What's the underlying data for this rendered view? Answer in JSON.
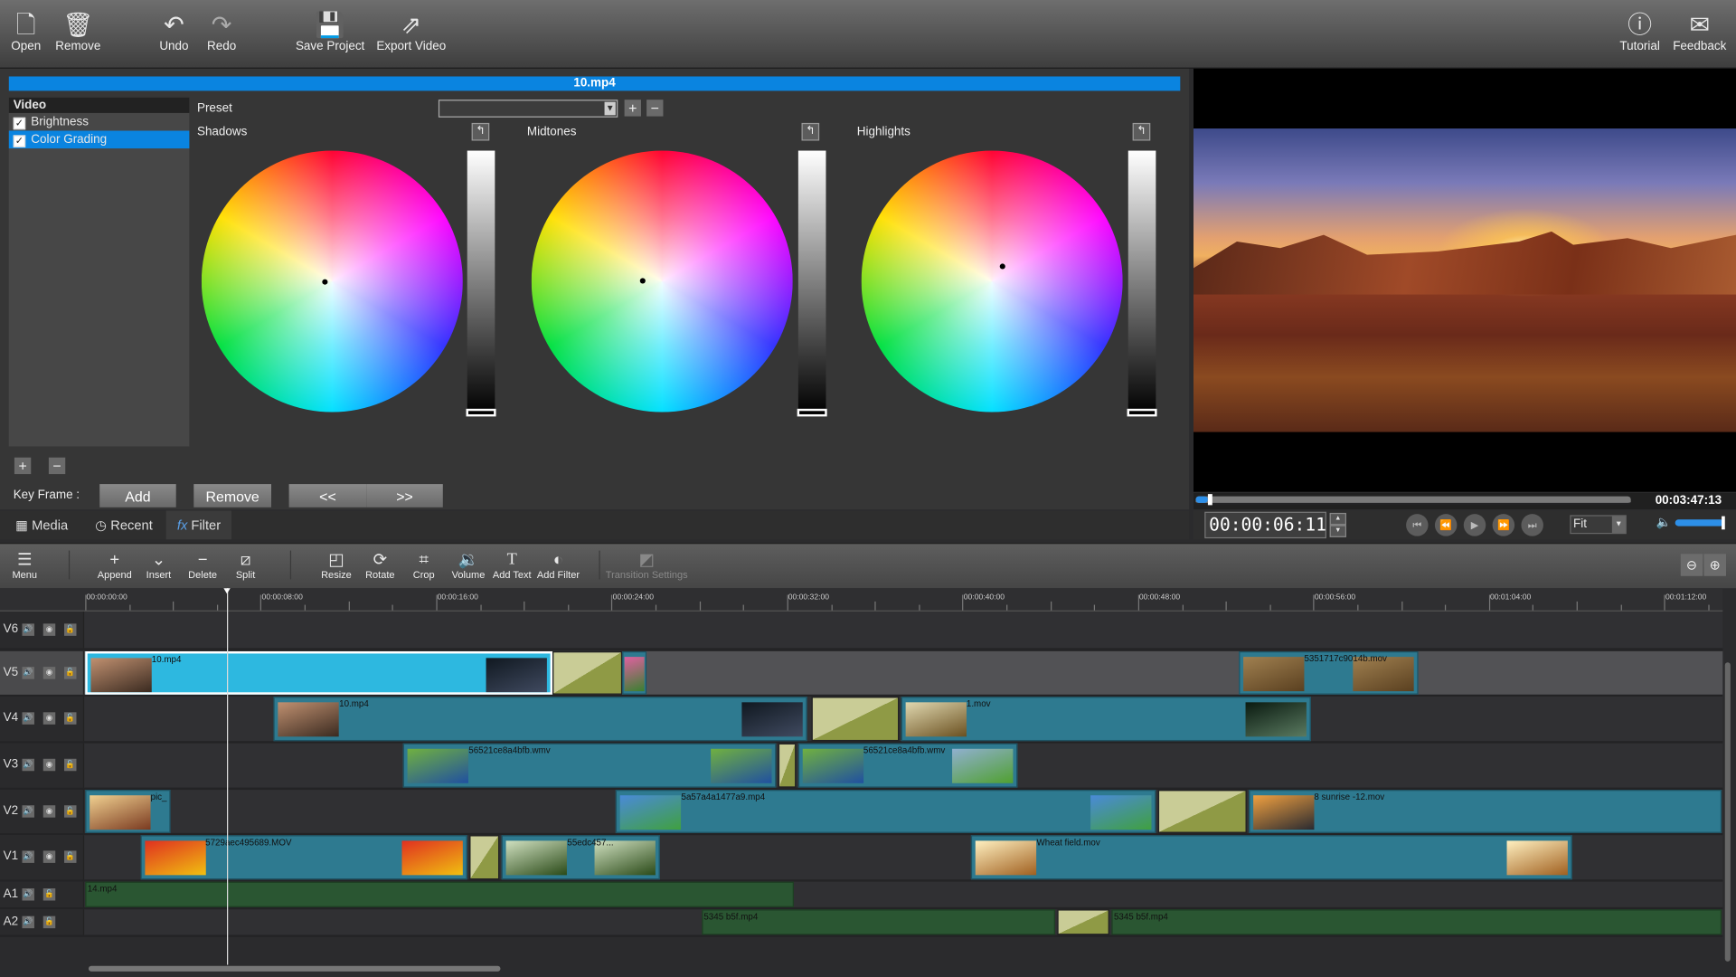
{
  "toolbar": {
    "open": "Open",
    "remove": "Remove",
    "undo": "Undo",
    "redo": "Redo",
    "save_project": "Save Project",
    "export_video": "Export Video",
    "tutorial": "Tutorial",
    "feedback": "Feedback"
  },
  "editor": {
    "clip_title": "10.mp4",
    "filter_list": {
      "header": "Video",
      "items": [
        {
          "label": "Brightness",
          "checked": true
        },
        {
          "label": "Color Grading",
          "checked": true,
          "selected": true
        }
      ]
    },
    "preset_label": "Preset",
    "preset_value": "",
    "wheels": [
      {
        "label": "Shadows"
      },
      {
        "label": "Midtones"
      },
      {
        "label": "Highlights"
      }
    ],
    "keyframe_label": "Key Frame :",
    "keyframe_add": "Add",
    "keyframe_remove": "Remove",
    "keyframe_prev": "<<",
    "keyframe_next": ">>"
  },
  "tabs": [
    {
      "label": "Media",
      "icon": "film-icon"
    },
    {
      "label": "Recent",
      "icon": "clock-icon"
    },
    {
      "label": "Filter",
      "icon": "fx-icon",
      "active": true
    }
  ],
  "preview": {
    "duration": "00:03:47:13",
    "current_time": "00:00:06:11",
    "zoom_mode": "Fit",
    "progress_percent": 2.8,
    "volume_percent": 100
  },
  "timeline_toolbar": {
    "menu": "Menu",
    "append": "Append",
    "insert": "Insert",
    "delete": "Delete",
    "split": "Split",
    "resize": "Resize",
    "rotate": "Rotate",
    "crop": "Crop",
    "volume": "Volume",
    "add_text": "Add Text",
    "add_filter": "Add Filter",
    "transition_settings": "Transition Settings"
  },
  "ruler": [
    "00:00:00:00",
    "00:00:08:00",
    "00:00:16:00",
    "00:00:24:00",
    "00:00:32:00",
    "00:00:40:00",
    "00:00:48:00",
    "00:00:56:00",
    "00:01:04:00",
    "00:01:12:00"
  ],
  "playhead_seconds": 6.46,
  "colors": {
    "accent": "#0a84e0",
    "video_clip": "#2e7a90",
    "selected_clip": "#2db8e0",
    "audio_clip": "#2a5632",
    "transition": "#8f9a45"
  },
  "tracks": [
    {
      "name": "V6",
      "type": "video",
      "clips": []
    },
    {
      "name": "V5",
      "type": "video",
      "selected": true,
      "clips": [
        {
          "label": "10.mp4",
          "start": 0,
          "end": 21.3,
          "selected": true,
          "thumbs": [
            [
              "#c09070",
              "#3a2a20"
            ],
            [
              "#101820",
              "#404a60"
            ]
          ]
        },
        {
          "transition": true,
          "start": 21.3,
          "end": 24.5
        },
        {
          "label": "",
          "start": 24.5,
          "end": 25.6,
          "thumbs": [
            [
              "#e060a0",
              "#3a8030"
            ]
          ]
        },
        {
          "label": "5351717c9014b.mov",
          "start": 52.6,
          "end": 60.8,
          "thumbs": [
            [
              "#a08050",
              "#5a4020"
            ],
            [
              "#a08050",
              "#5a4020"
            ]
          ]
        }
      ]
    },
    {
      "name": "V4",
      "type": "video",
      "clips": [
        {
          "label": "10.mp4",
          "start": 8.6,
          "end": 32.9,
          "thumbs": [
            [
              "#c09070",
              "#3a2a20"
            ],
            [
              "#101820",
              "#404a60"
            ]
          ]
        },
        {
          "transition": true,
          "start": 33.1,
          "end": 37.1
        },
        {
          "label": "1.mov",
          "start": 37.2,
          "end": 55.9,
          "thumbs": [
            [
              "#e0d8b0",
              "#6a5020"
            ],
            [
              "#0a1a10",
              "#5a7a60"
            ]
          ]
        }
      ]
    },
    {
      "name": "V3",
      "type": "video",
      "clips": [
        {
          "label": "56521ce8a4bfb.wmv",
          "start": 14.5,
          "end": 31.5,
          "thumbs": [
            [
              "#70b040",
              "#2050a0"
            ],
            [
              "#70b040",
              "#2050a0"
            ]
          ]
        },
        {
          "transition": true,
          "start": 31.6,
          "end": 32.4
        },
        {
          "label": "56521ce8a4bfb.wmv",
          "start": 32.5,
          "end": 42.5,
          "thumbs": [
            [
              "#70b040",
              "#2050a0"
            ],
            [
              "#90b0d0",
              "#50a030"
            ]
          ]
        }
      ]
    },
    {
      "name": "V2",
      "type": "video",
      "clips": [
        {
          "label": "pic_",
          "start": 0,
          "end": 3.9,
          "thumbs": [
            [
              "#f0d090",
              "#7a3a20"
            ]
          ]
        },
        {
          "label": "5a57a4a1477a9.mp4",
          "start": 24.2,
          "end": 48.8,
          "thumbs": [
            [
              "#4a8ad8",
              "#40a040"
            ],
            [
              "#4a8ad8",
              "#40a040"
            ]
          ]
        },
        {
          "transition": true,
          "start": 48.9,
          "end": 52.96
        },
        {
          "label": "8 sunrise -12.mov",
          "start": 53.05,
          "end": 74.6,
          "thumbs": [
            [
              "#f0a040",
              "#2a2a30"
            ]
          ]
        }
      ]
    },
    {
      "name": "V1",
      "type": "video",
      "clips": [
        {
          "label": "5729aec495689.MOV",
          "start": 2.5,
          "end": 17.4,
          "thumbs": [
            [
              "#e03020",
              "#f0c010"
            ],
            [
              "#e03020",
              "#f0c010"
            ]
          ]
        },
        {
          "transition": true,
          "start": 17.5,
          "end": 18.9
        },
        {
          "label": "55edc457...",
          "start": 19.0,
          "end": 26.2,
          "thumbs": [
            [
              "#d0e0c0",
              "#2a4a18"
            ],
            [
              "#d0e0c0",
              "#2a4a18"
            ]
          ]
        },
        {
          "label": "Wheat field.mov",
          "start": 40.4,
          "end": 67.8,
          "thumbs": [
            [
              "#fff0c0",
              "#a06020"
            ],
            [
              "#fff0c0",
              "#a06020"
            ]
          ]
        }
      ]
    },
    {
      "name": "A1",
      "type": "audio",
      "clips": [
        {
          "label": "14.mp4",
          "start": 0,
          "end": 32.3
        }
      ]
    },
    {
      "name": "A2",
      "type": "audio",
      "clips": [
        {
          "label": "5345 b5f.mp4",
          "start": 28.1,
          "end": 44.2
        },
        {
          "transition": true,
          "start": 44.3,
          "end": 46.7
        },
        {
          "label": "5345 b5f.mp4",
          "start": 46.8,
          "end": 74.6
        }
      ]
    }
  ]
}
